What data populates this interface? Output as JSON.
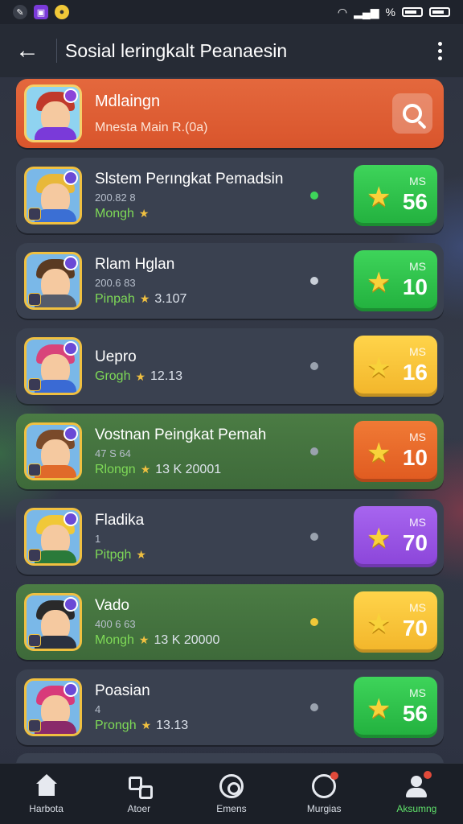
{
  "status_bar": {
    "signal_text": "%"
  },
  "header": {
    "title": "Sosial leringkalt Peanaesin"
  },
  "top_entry": {
    "name": "Mdlaingn",
    "subtitle": "Mnesta  Main R.(0a)"
  },
  "rows": [
    {
      "name": "Slstem Perıngkat Pemadsin",
      "sub": "200.82 8",
      "meta_label": "Mongh",
      "meta_value": "",
      "dot_color": "#3ed45a",
      "score_label": "MS",
      "score": "56",
      "score_color": "green",
      "style": "dark",
      "hair": "#e8b83a",
      "shirt": "#3b6fd4"
    },
    {
      "name": "Rlam Hglan",
      "sub": "200.6 83",
      "meta_label": "Pinpah",
      "meta_value": "3.107",
      "dot_color": "#c9cfd8",
      "score_label": "MS",
      "score": "10",
      "score_color": "green",
      "style": "dark",
      "hair": "#5a3a22",
      "shirt": "#555c6a"
    },
    {
      "name": "Uepro",
      "sub": "",
      "meta_label": "Grogh",
      "meta_value": "12.13",
      "dot_color": "#9aa2ae",
      "score_label": "MS",
      "score": "16",
      "score_color": "yellow",
      "style": "dark",
      "hair": "#d8447a",
      "shirt": "#3a6ad4"
    },
    {
      "name": "Vostnan Peingkat Pemah",
      "sub": "47 S 64",
      "meta_label": "Rlongn",
      "meta_value": "13 K 20001",
      "dot_color": "#9aa2ae",
      "score_label": "MS",
      "score": "10",
      "score_color": "orange",
      "style": "green",
      "hair": "#7a4a2a",
      "shirt": "#e06a2a"
    },
    {
      "name": "Fladika",
      "sub": "1",
      "meta_label": "Pitpgh",
      "meta_value": "",
      "dot_color": "#9aa2ae",
      "score_label": "MS",
      "score": "70",
      "score_color": "purple",
      "style": "dark",
      "hair": "#f0c838",
      "shirt": "#2a7a3a"
    },
    {
      "name": "Vado",
      "sub": "400 6 63",
      "meta_label": "Mongh",
      "meta_value": "13 K 20000",
      "dot_color": "#f0c838",
      "score_label": "MS",
      "score": "70",
      "score_color": "yellow",
      "style": "green",
      "hair": "#2a2a2a",
      "shirt": "#2a3140"
    },
    {
      "name": "Poasian",
      "sub": "4",
      "meta_label": "Prongh",
      "meta_value": "13.13",
      "dot_color": "#9aa2ae",
      "score_label": "MS",
      "score": "56",
      "score_color": "green",
      "style": "dark",
      "hair": "#d83a7a",
      "shirt": "#8a2a6a"
    }
  ],
  "bottom_nav": [
    {
      "label": "Harbota",
      "icon": "home-icon",
      "active": false
    },
    {
      "label": "Atoer",
      "icon": "grid-icon",
      "active": false
    },
    {
      "label": "Emens",
      "icon": "target-icon",
      "active": false
    },
    {
      "label": "Murgias",
      "icon": "chat-icon",
      "active": false
    },
    {
      "label": "Aksumng",
      "icon": "user-icon",
      "active": true
    }
  ],
  "colors": {
    "accent_orange": "#d9552c",
    "score_green": "#22b03e",
    "score_yellow": "#f2b52a",
    "score_orange": "#e05a20",
    "score_purple": "#8b45d9",
    "active_nav": "#5fe06a"
  }
}
